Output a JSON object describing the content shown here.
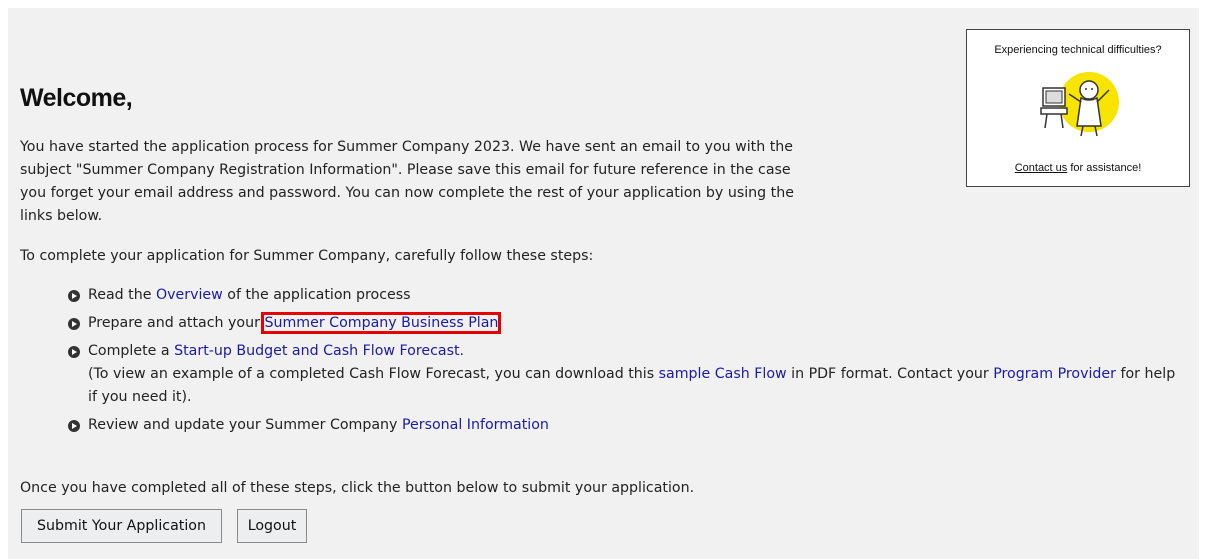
{
  "help": {
    "title": "Experiencing technical difficulties?",
    "illustration_icon": "person-at-computer-icon",
    "contact_link": "Contact us",
    "contact_rest": " for assistance!"
  },
  "welcome": {
    "title": "Welcome,"
  },
  "intro": "You have started the application process for Summer Company 2023. We have sent an email to you with the subject \"Summer Company Registration Information\". Please save this email for future reference in the case you forget your email address and password. You can now complete the rest of your application by using the links below.",
  "lead": "To complete your application for Summer Company, carefully follow these steps:",
  "steps": [
    {
      "before": "Read the ",
      "link": "Overview",
      "after": " of the application process"
    },
    {
      "before": "Prepare and attach your ",
      "link": "Summer Company Business Plan",
      "after": ""
    },
    {
      "before": "Complete a ",
      "link": "Start-up Budget and Cash Flow Forecast.",
      "after": "",
      "note_before": "(To view an example of a completed Cash Flow Forecast, you can download this ",
      "note_link1": "sample Cash Flow",
      "note_mid": " in PDF format. Contact your ",
      "note_link2": "Program Provider",
      "note_after": " for help if you need it)."
    },
    {
      "before": "Review and update your Summer Company ",
      "link": "Personal Information",
      "after": ""
    }
  ],
  "closing": "Once you have completed all of these steps, click the button below to submit your application.",
  "buttons": {
    "submit": "Submit Your Application",
    "logout": "Logout"
  },
  "colors": {
    "link": "#1a1aa8",
    "highlight": "#e60000",
    "background": "#f1f1f1"
  }
}
